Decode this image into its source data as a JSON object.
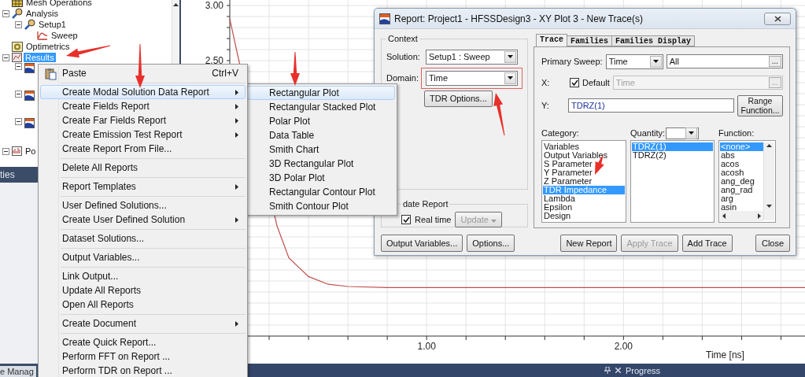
{
  "tree": {
    "items": [
      {
        "kind": "mesh",
        "label": "Mesh Operations",
        "selected": false
      },
      {
        "kind": "analysis",
        "label": "Analysis",
        "selected": false,
        "expanded": true,
        "children": [
          {
            "kind": "setup",
            "label": "Setup1",
            "selected": false,
            "expanded": true,
            "children": [
              {
                "kind": "sweep",
                "label": "Sweep",
                "selected": false
              }
            ]
          }
        ]
      },
      {
        "kind": "optimetrics",
        "label": "Optimetrics",
        "selected": false
      },
      {
        "kind": "results",
        "label": "Results",
        "selected": true,
        "expanded": true,
        "children": [
          {
            "kind": "report",
            "expanded": true
          },
          {
            "kind": "report",
            "expanded": true
          },
          {
            "kind": "report",
            "expanded": true
          }
        ]
      },
      {
        "kind": "port",
        "label": "Po",
        "selected": false,
        "expanded": true
      }
    ]
  },
  "left_panel_tab": "ties",
  "bottom_tab": "e Manag",
  "plot": {
    "chart_data": {
      "type": "line",
      "xlabel": "Time [ns]",
      "grid": true,
      "x": [
        0,
        0.04,
        0.24,
        0.3,
        0.4,
        0.5,
        0.6,
        0.8,
        1.0,
        1.5,
        2.0,
        2.5,
        2.93
      ],
      "series": [
        {
          "color": "#c0504d",
          "values": [
            2.88,
            2.55,
            1.0,
            0.71,
            0.54,
            0.47,
            0.45,
            0.44,
            0.44,
            0.44,
            0.44,
            0.44,
            0.44
          ]
        }
      ],
      "xlim": [
        0,
        2.93
      ],
      "ylim": [
        0,
        3
      ],
      "xticks": [
        {
          "value": 1,
          "label": "1.00"
        },
        {
          "value": 2,
          "label": "2.00"
        }
      ],
      "yticks": [
        {
          "value": 2.5,
          "label": "2.50"
        },
        {
          "value": 3,
          "label": "3.00"
        }
      ]
    }
  },
  "progress_panel": {
    "title": "Progress"
  },
  "context_menu": {
    "items": [
      {
        "kind": "paste",
        "label": "Paste",
        "shortcut": "Ctrl+V",
        "submenu": false,
        "selected": false
      },
      {
        "kind": "separator"
      },
      {
        "kind": "item",
        "label": "Create Modal Solution Data Report",
        "submenu": true,
        "selected": true
      },
      {
        "kind": "item",
        "label": "Create Fields Report",
        "submenu": true,
        "selected": false
      },
      {
        "kind": "item",
        "label": "Create Far Fields Report",
        "submenu": true,
        "selected": false
      },
      {
        "kind": "item",
        "label": "Create Emission Test Report",
        "submenu": true,
        "selected": false
      },
      {
        "kind": "item",
        "label": "Create Report From File...",
        "submenu": false,
        "selected": false
      },
      {
        "kind": "separator"
      },
      {
        "kind": "item",
        "label": "Delete All Reports",
        "submenu": false,
        "selected": false
      },
      {
        "kind": "separator"
      },
      {
        "kind": "item",
        "label": "Report Templates",
        "submenu": true,
        "selected": false
      },
      {
        "kind": "separator"
      },
      {
        "kind": "item",
        "label": "User Defined Solutions...",
        "submenu": false,
        "selected": false
      },
      {
        "kind": "item",
        "label": "Create User Defined Solution",
        "submenu": true,
        "selected": false
      },
      {
        "kind": "separator"
      },
      {
        "kind": "item",
        "label": "Dataset Solutions...",
        "submenu": false,
        "selected": false
      },
      {
        "kind": "separator"
      },
      {
        "kind": "item",
        "label": "Output Variables...",
        "submenu": false,
        "selected": false
      },
      {
        "kind": "separator"
      },
      {
        "kind": "item",
        "label": "Link Output...",
        "submenu": false,
        "selected": false
      },
      {
        "kind": "item",
        "label": "Update All Reports",
        "submenu": false,
        "selected": false
      },
      {
        "kind": "item",
        "label": "Open All Reports",
        "submenu": false,
        "selected": false
      },
      {
        "kind": "separator"
      },
      {
        "kind": "item",
        "label": "Create Document",
        "submenu": true,
        "selected": false
      },
      {
        "kind": "separator"
      },
      {
        "kind": "item",
        "label": "Create Quick Report...",
        "submenu": false,
        "selected": false
      },
      {
        "kind": "item",
        "label": "Perform FFT on Report ...",
        "submenu": false,
        "selected": false
      },
      {
        "kind": "item",
        "label": "Perform TDR on Report ...",
        "submenu": false,
        "selected": false
      }
    ]
  },
  "submenu": {
    "items": [
      {
        "label": "Rectangular Plot",
        "selected": true
      },
      {
        "label": "Rectangular Stacked Plot",
        "selected": false
      },
      {
        "label": "Polar Plot",
        "selected": false
      },
      {
        "label": "Data Table",
        "selected": false
      },
      {
        "label": "Smith Chart",
        "selected": false
      },
      {
        "label": "3D Rectangular Plot",
        "selected": false
      },
      {
        "label": "3D Polar Plot",
        "selected": false
      },
      {
        "label": "Rectangular Contour Plot",
        "selected": false
      },
      {
        "label": "Smith Contour Plot",
        "selected": false
      }
    ]
  },
  "dialog": {
    "title": "Report: Project1 - HFSSDesign3 - XY Plot 3 - New Trace(s)",
    "context": {
      "legend": "Context",
      "solution_label": "Solution:",
      "solution": "Setup1 : Sweep",
      "domain_label": "Domain:",
      "domain": "Time",
      "tdr_button": "TDR Options..."
    },
    "update": {
      "legend": "date Report",
      "realtime_label": "Real time",
      "realtime_checked": true,
      "update_button": "Update",
      "update_disabled": true
    },
    "tabs": [
      {
        "label": "Trace",
        "selected": true
      },
      {
        "label": "Families",
        "selected": false
      },
      {
        "label": "Families Display",
        "selected": false
      }
    ],
    "primary_sweep": {
      "label": "Primary Sweep:",
      "value": "Time",
      "range": "All",
      "browse": "..."
    },
    "x": {
      "label": "X:",
      "default_label": "Default",
      "default_checked": true,
      "value": "Time",
      "browse": "..."
    },
    "y": {
      "label": "Y:",
      "value": "TDRZ(1)",
      "button": "Range Function..."
    },
    "category": {
      "label": "Category:",
      "items": [
        {
          "label": "Variables",
          "selected": false
        },
        {
          "label": "Output Variables",
          "selected": false
        },
        {
          "label": "S Parameter",
          "selected": false
        },
        {
          "label": "Y Parameter",
          "selected": false
        },
        {
          "label": "Z Parameter",
          "selected": false
        },
        {
          "label": "TDR Impedance",
          "selected": true
        },
        {
          "label": "Lambda",
          "selected": false
        },
        {
          "label": "Epsilon",
          "selected": false
        },
        {
          "label": "Design",
          "selected": false
        }
      ]
    },
    "quantity": {
      "label": "Quantity:",
      "items": [
        {
          "label": "TDRZ(1)",
          "selected": true
        },
        {
          "label": "TDRZ(2)",
          "selected": false
        }
      ]
    },
    "function": {
      "label": "Function:",
      "items": [
        {
          "label": "<none>",
          "selected": true
        },
        {
          "label": "abs",
          "selected": false
        },
        {
          "label": "acos",
          "selected": false
        },
        {
          "label": "acosh",
          "selected": false
        },
        {
          "label": "ang_deg",
          "selected": false
        },
        {
          "label": "ang_rad",
          "selected": false
        },
        {
          "label": "arg",
          "selected": false
        },
        {
          "label": "asin",
          "selected": false
        }
      ]
    },
    "context_buttons": [
      {
        "label": "Output Variables...",
        "disabled": false
      },
      {
        "label": "Options...",
        "disabled": false
      }
    ],
    "trace_buttons": [
      {
        "label": "New Report",
        "disabled": false
      },
      {
        "label": "Apply Trace",
        "disabled": true
      },
      {
        "label": "Add Trace",
        "disabled": false
      }
    ],
    "close_button": "Close"
  }
}
